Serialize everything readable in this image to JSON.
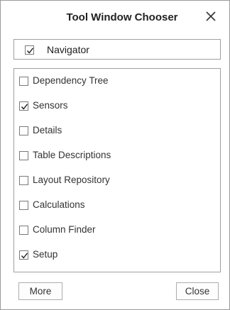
{
  "dialog": {
    "title": "Tool Window Chooser"
  },
  "navigator": {
    "label": "Navigator",
    "checked": true
  },
  "items": [
    {
      "label": "Dependency Tree",
      "checked": false
    },
    {
      "label": "Sensors",
      "checked": true
    },
    {
      "label": "Details",
      "checked": false
    },
    {
      "label": "Table Descriptions",
      "checked": false
    },
    {
      "label": "Layout Repository",
      "checked": false
    },
    {
      "label": "Calculations",
      "checked": false
    },
    {
      "label": "Column Finder",
      "checked": false
    },
    {
      "label": "Setup",
      "checked": true
    }
  ],
  "buttons": {
    "more_label": "More",
    "close_label": "Close"
  }
}
